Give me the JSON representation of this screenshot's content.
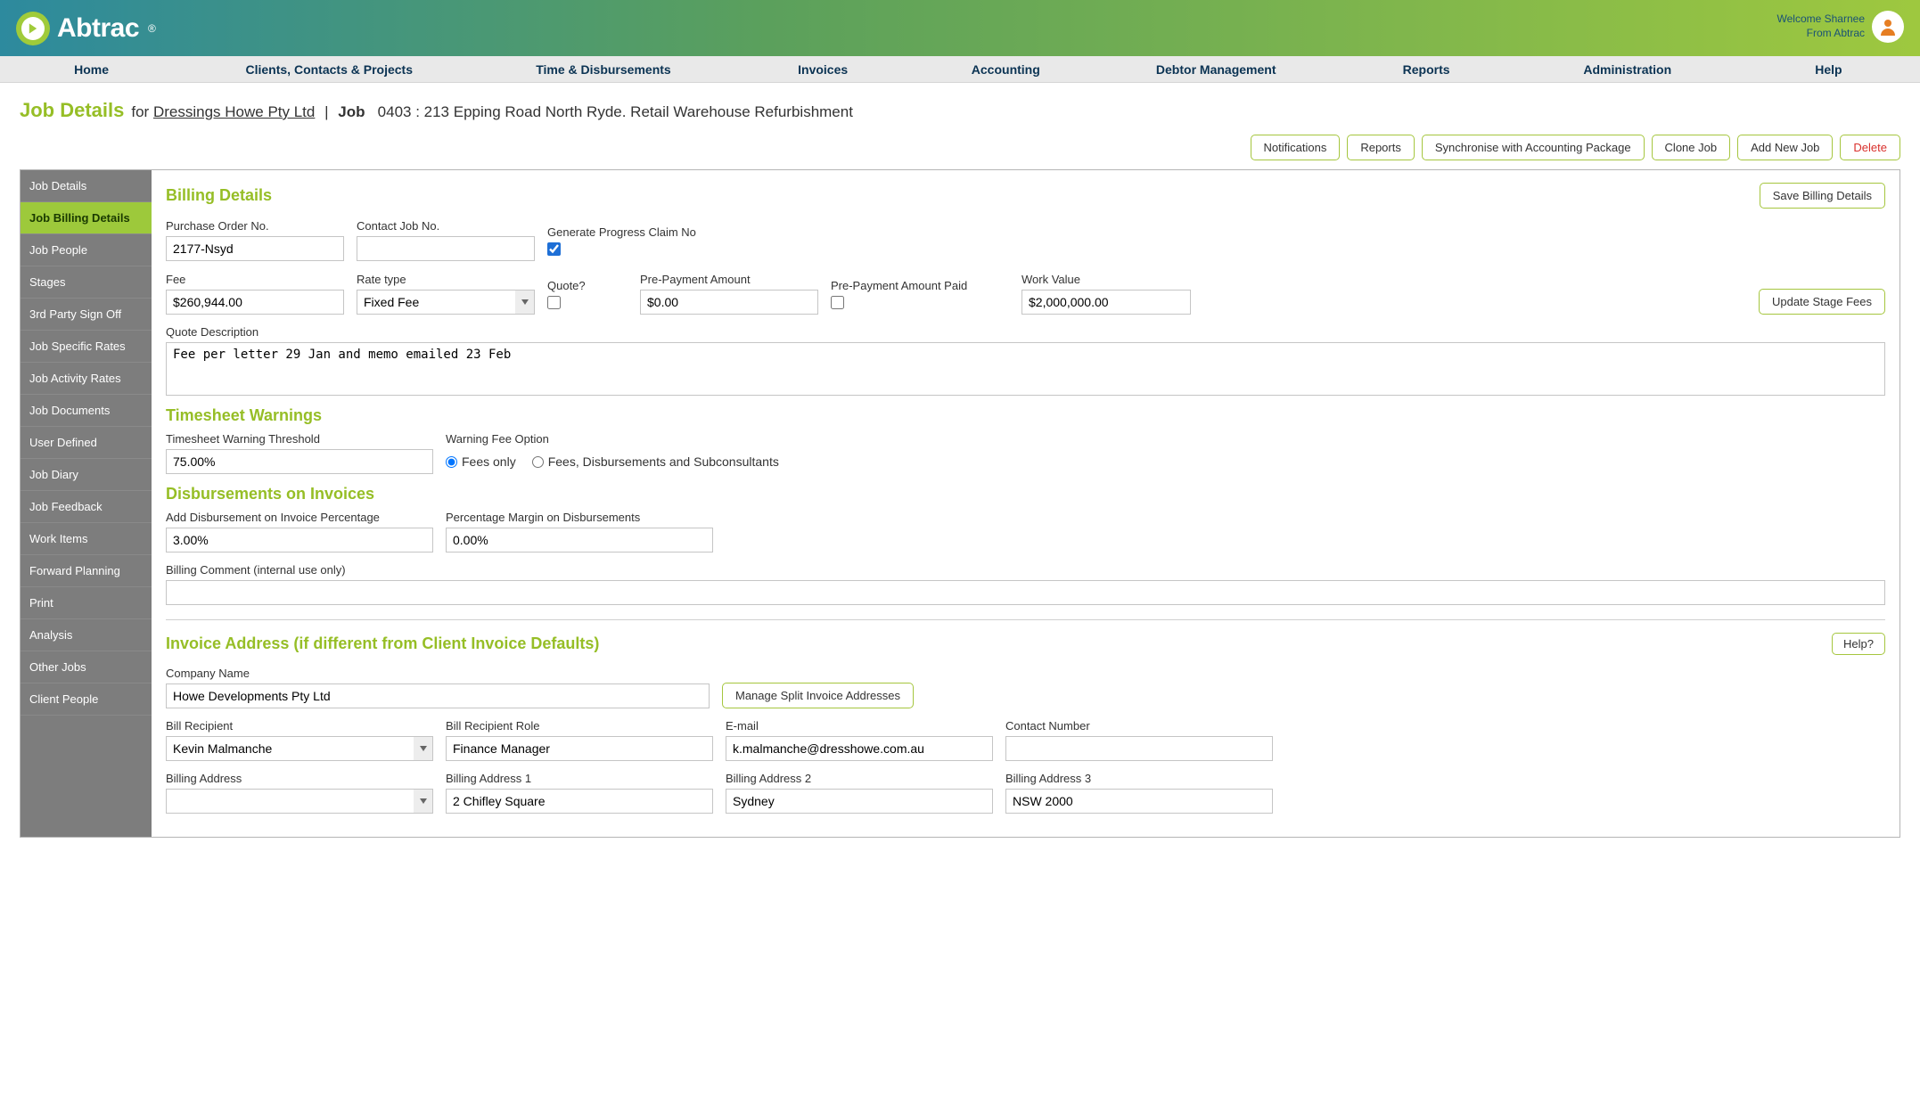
{
  "header": {
    "brand": "Abtrac",
    "reg_mark": "®",
    "welcome_line1": "Welcome Sharnee",
    "welcome_line2": "From Abtrac"
  },
  "navbar": [
    "Home",
    "Clients, Contacts & Projects",
    "Time & Disbursements",
    "Invoices",
    "Accounting",
    "Debtor Management",
    "Reports",
    "Administration",
    "Help"
  ],
  "page": {
    "title": "Job Details",
    "for_label": "for",
    "client": "Dressings Howe Pty Ltd",
    "job_label": "Job",
    "job_ref": "0403 : 213 Epping Road North Ryde. Retail Warehouse Refurbishment"
  },
  "actions": {
    "notifications": "Notifications",
    "reports": "Reports",
    "sync": "Synchronise with Accounting Package",
    "clone": "Clone Job",
    "add_new": "Add New Job",
    "delete": "Delete"
  },
  "sidebar": [
    "Job Details",
    "Job Billing Details",
    "Job People",
    "Stages",
    "3rd Party Sign Off",
    "Job Specific Rates",
    "Job Activity Rates",
    "Job Documents",
    "User Defined",
    "Job Diary",
    "Job Feedback",
    "Work Items",
    "Forward Planning",
    "Print",
    "Analysis",
    "Other Jobs",
    "Client People"
  ],
  "sidebar_active_index": 1,
  "billing": {
    "section_title": "Billing Details",
    "save_btn": "Save Billing Details",
    "po_label": "Purchase Order No.",
    "po_value": "2177-Nsyd",
    "contact_job_label": "Contact Job No.",
    "contact_job_value": "",
    "gen_progress_label": "Generate Progress Claim No",
    "gen_progress_checked": true,
    "fee_label": "Fee",
    "fee_value": "$260,944.00",
    "rate_type_label": "Rate type",
    "rate_type_value": "Fixed Fee",
    "quote_label": "Quote?",
    "quote_checked": false,
    "prepay_label": "Pre-Payment Amount",
    "prepay_value": "$0.00",
    "prepay_paid_label": "Pre-Payment Amount Paid",
    "prepay_paid_checked": false,
    "work_value_label": "Work Value",
    "work_value_value": "$2,000,000.00",
    "update_stage_btn": "Update Stage Fees",
    "quote_desc_label": "Quote Description",
    "quote_desc_value": "Fee per letter 29 Jan and memo emailed 23 Feb"
  },
  "timesheet": {
    "section_title": "Timesheet Warnings",
    "threshold_label": "Timesheet Warning Threshold",
    "threshold_value": "75.00%",
    "warning_option_label": "Warning Fee Option",
    "opt_fees_only": "Fees only",
    "opt_fees_disb": "Fees, Disbursements and Subconsultants",
    "selected_option": "fees_only"
  },
  "disbursements": {
    "section_title": "Disbursements on Invoices",
    "add_pct_label": "Add Disbursement on Invoice Percentage",
    "add_pct_value": "3.00%",
    "margin_pct_label": "Percentage Margin on Disbursements",
    "margin_pct_value": "0.00%",
    "billing_comment_label": "Billing Comment (internal use only)",
    "billing_comment_value": ""
  },
  "invoice_address": {
    "section_title": "Invoice Address (if different from Client Invoice Defaults)",
    "help_btn": "Help?",
    "company_label": "Company Name",
    "company_value": "Howe Developments Pty Ltd",
    "manage_split_btn": "Manage Split Invoice Addresses",
    "recipient_label": "Bill Recipient",
    "recipient_value": "Kevin Malmanche",
    "recipient_role_label": "Bill Recipient Role",
    "recipient_role_value": "Finance Manager",
    "email_label": "E-mail",
    "email_value": "k.malmanche@dresshowe.com.au",
    "contact_num_label": "Contact Number",
    "contact_num_value": "",
    "addr_label": "Billing Address",
    "addr_value": "",
    "addr1_label": "Billing Address 1",
    "addr1_value": "2 Chifley Square",
    "addr2_label": "Billing Address 2",
    "addr2_value": "Sydney",
    "addr3_label": "Billing Address 3",
    "addr3_value": "NSW 2000"
  }
}
